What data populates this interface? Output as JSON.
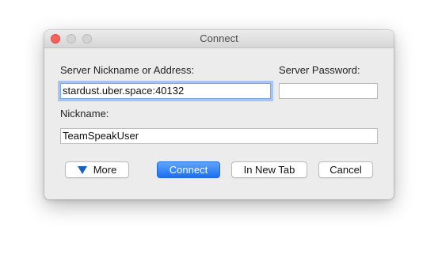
{
  "window": {
    "title": "Connect"
  },
  "form": {
    "address_label": "Server Nickname or Address:",
    "address_value": "stardust.uber.space:40132",
    "password_label": "Server Password:",
    "password_value": "",
    "nickname_label": "Nickname:",
    "nickname_value": "TeamSpeakUser"
  },
  "buttons": {
    "more_label": "More",
    "more_icon": "disclosure-triangle-down-icon",
    "connect_label": "Connect",
    "new_tab_label": "In New Tab",
    "cancel_label": "Cancel"
  },
  "colors": {
    "accent": "#1e6fef",
    "focus_ring": "#a7c5f3",
    "close_light": "#fc605c"
  }
}
